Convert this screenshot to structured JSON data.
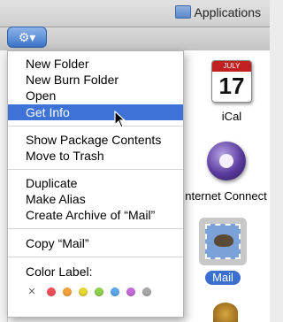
{
  "window": {
    "title": "Applications"
  },
  "toolbar": {
    "action_glyph": "⚙▾"
  },
  "desktop_icons": {
    "ical": {
      "label": "iCal",
      "month": "JULY",
      "day": "17"
    },
    "connect": {
      "label": "nternet Connect"
    },
    "mail": {
      "label": "Mail"
    }
  },
  "menu": {
    "group1": [
      "New Folder",
      "New Burn Folder",
      "Open",
      "Get Info"
    ],
    "highlighted": "Get Info",
    "group2": [
      "Show Package Contents",
      "Move to Trash"
    ],
    "group3": [
      "Duplicate",
      "Make Alias",
      "Create Archive of “Mail”"
    ],
    "group4": [
      "Copy “Mail”"
    ],
    "color_label_title": "Color Label:",
    "label_colors": {
      "none": "✕",
      "red": "#f0505a",
      "orange": "#f5a23a",
      "yellow": "#e8d830",
      "green": "#8fd24a",
      "blue": "#5aa8ec",
      "purple": "#c46ad8",
      "gray": "#a8a8a8"
    }
  },
  "colors": {
    "accent": "#3d72d6",
    "selection_label": "#3a6fd0"
  }
}
